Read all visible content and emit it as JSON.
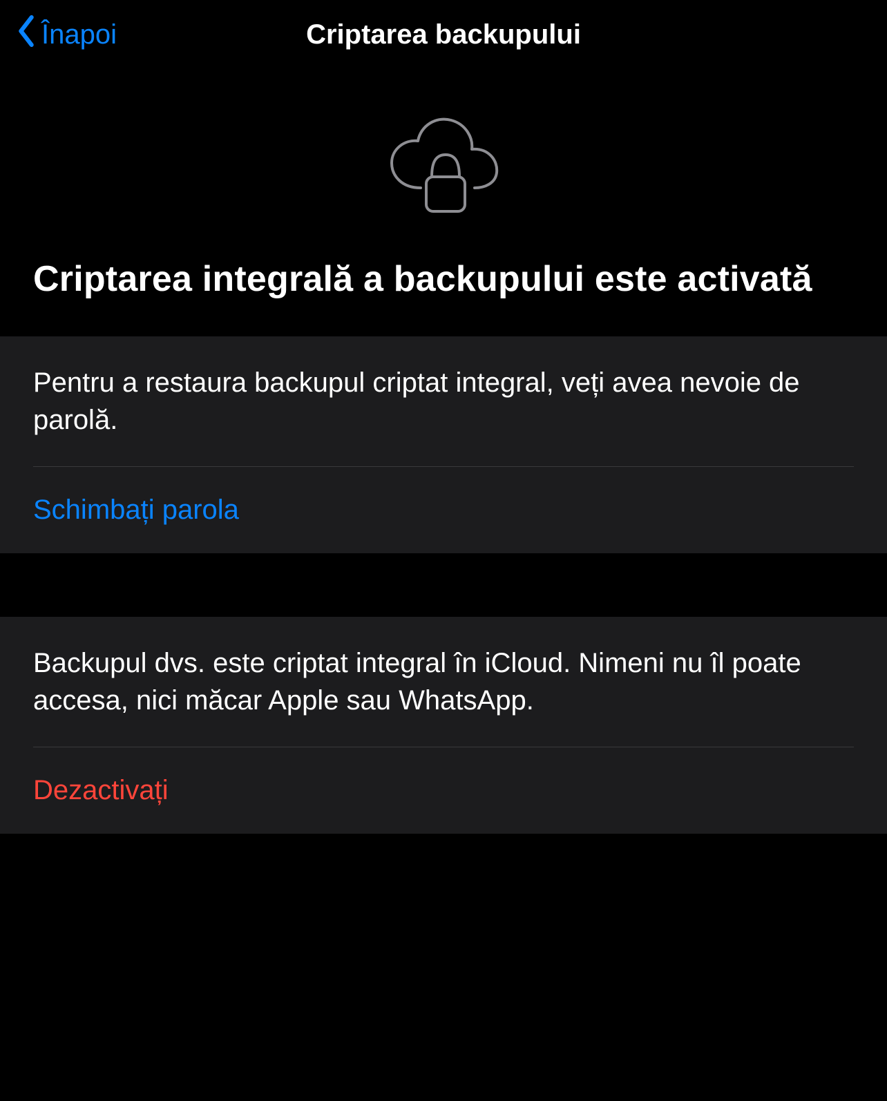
{
  "header": {
    "back_label": "Înapoi",
    "title": "Criptarea backupului"
  },
  "hero": {
    "heading": "Criptarea integrală a backupului este activată"
  },
  "group1": {
    "description": "Pentru a restaura backupul criptat integral, veți avea nevoie de parolă.",
    "change_password_label": "Schimbați parola"
  },
  "group2": {
    "description": "Backupul dvs. este criptat integral în iCloud. Nimeni nu îl poate accesa, nici măcar Apple sau WhatsApp.",
    "deactivate_label": "Dezactivați"
  }
}
